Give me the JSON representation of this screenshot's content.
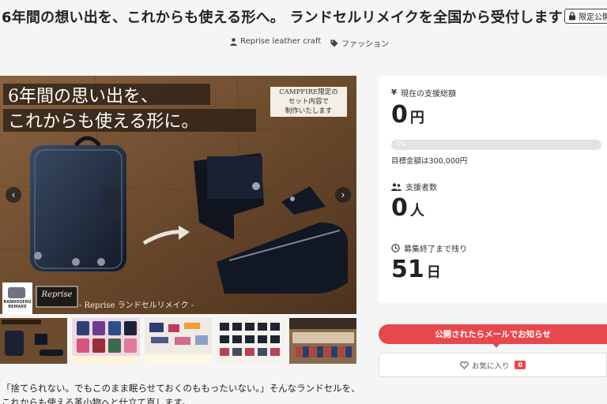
{
  "header": {
    "title": "6年間の想い出を、これからも使える形へ。 ランドセルリメイクを全国から受付します",
    "badge": "限定公開"
  },
  "meta": {
    "owner": "Reprise leather craft",
    "category": "ファッション"
  },
  "hero": {
    "headline_line1": "6年間の思い出を、",
    "headline_line2": "これからも使える形に。",
    "campfire_note_line1": "CAMPFIRE限定の",
    "campfire_note_line2": "セット内容で",
    "campfire_note_line3": "制作いたします",
    "logo_line1": "RANDOSERU",
    "logo_line2": "REMAKE",
    "brand_script": "Reprise",
    "footer_caption": "- Reprise ランドセルリメイク -",
    "prev_arrow": "‹",
    "next_arrow": "›"
  },
  "thumbnails": [
    {
      "alt": "thumbnail-1"
    },
    {
      "alt": "thumbnail-2"
    },
    {
      "alt": "thumbnail-3"
    },
    {
      "alt": "thumbnail-4"
    },
    {
      "alt": "thumbnail-5"
    }
  ],
  "stats": {
    "total_label": "現在の支援総額",
    "total_value": "0",
    "total_unit": "円",
    "progress_percent": 0,
    "progress_label": "0%",
    "goal_text": "目標金額は300,000円",
    "supporters_label": "支援者数",
    "supporters_value": "0",
    "supporters_unit": "人",
    "remaining_label": "募集終了まで残り",
    "remaining_value": "51",
    "remaining_unit": "日"
  },
  "actions": {
    "notify_label": "公開されたらメールでお知らせ",
    "favorite_label": "お気に入り",
    "favorite_count": "0"
  },
  "description": {
    "line1": "「捨てられない。でもこのまま眠らせておくのももったいない。」そんなランドセルを、",
    "line2": "これからも使える革小物へと仕立て直します。"
  },
  "colors": {
    "accent": "#e8474d",
    "background": "#f5f5f5",
    "card": "#ffffff"
  }
}
